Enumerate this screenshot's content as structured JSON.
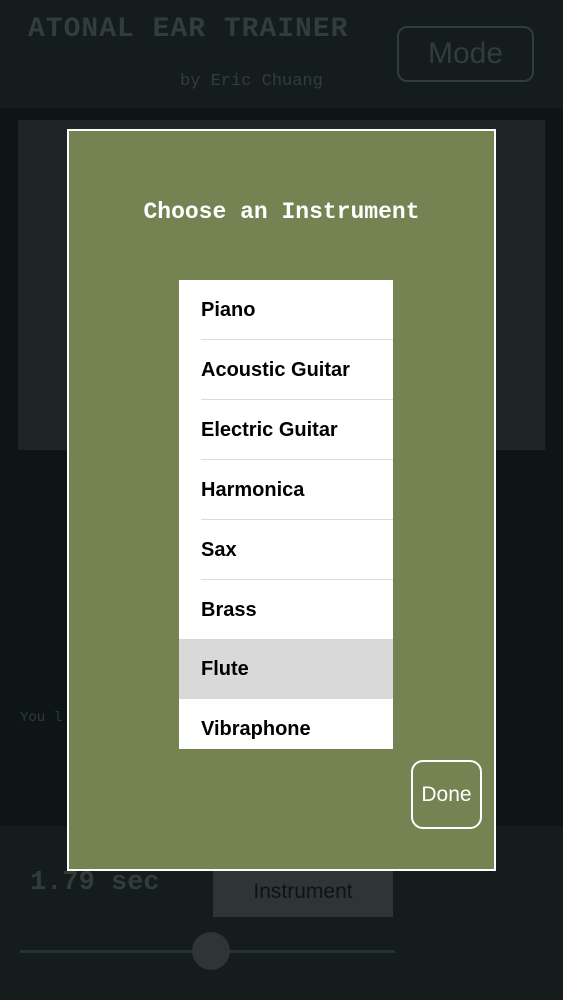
{
  "app": {
    "title": "ATONAL EAR TRAINER",
    "subtitle": "by Eric Chuang",
    "mode_label": "Mode",
    "you_text": "You l",
    "duration": "1.79 sec",
    "instrument_label": "Instrument",
    "slider_value": 0.5
  },
  "modal": {
    "title": "Choose an Instrument",
    "items": [
      {
        "label": "Piano"
      },
      {
        "label": "Acoustic Guitar"
      },
      {
        "label": "Electric Guitar"
      },
      {
        "label": "Harmonica"
      },
      {
        "label": "Sax"
      },
      {
        "label": "Brass"
      },
      {
        "label": "Flute"
      },
      {
        "label": "Vibraphone"
      }
    ],
    "selected": "Flute",
    "done_label": "Done"
  },
  "colors": {
    "background": "#0e1517",
    "modal": "#758353",
    "selected_row": "#d9d9d9"
  }
}
